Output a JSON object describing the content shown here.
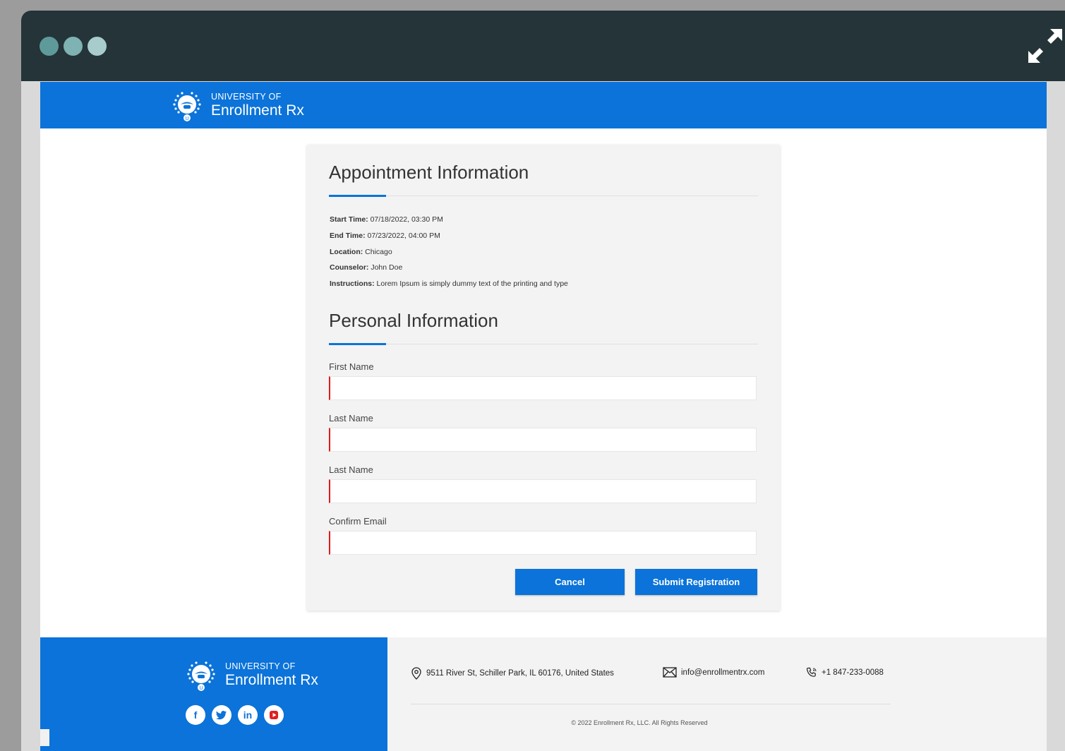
{
  "brand": {
    "subtitle": "UNIVERSITY OF",
    "name": "Enrollment Rx"
  },
  "appointment": {
    "title": "Appointment Information",
    "fields": [
      {
        "label": "Start Time:",
        "value": "07/18/2022,  03:30 PM"
      },
      {
        "label": "End Time:",
        "value": "07/23/2022,  04:00 PM"
      },
      {
        "label": "Location:",
        "value": "Chicago"
      },
      {
        "label": "Counselor:",
        "value": "John Doe"
      },
      {
        "label": "Instructions:",
        "value": "Lorem Ipsum is simply dummy text of the printing and type"
      }
    ]
  },
  "personal": {
    "title": "Personal Information",
    "fields": [
      {
        "label": "First Name",
        "value": ""
      },
      {
        "label": "Last Name",
        "value": ""
      },
      {
        "label": "Last Name",
        "value": ""
      },
      {
        "label": "Confirm Email",
        "value": ""
      }
    ]
  },
  "actions": {
    "cancel_label": "Cancel",
    "submit_label": "Submit Registration"
  },
  "footer": {
    "address": "9511 River St, Schiller Park, IL 60176,  United States",
    "email": "info@enrollmentrx.com",
    "phone": "+1 847-233-0088",
    "copyright": "© 2022 Enrollment Rx, LLC. All Rights Reserved",
    "socials": [
      {
        "name": "facebook",
        "glyph": "f"
      },
      {
        "name": "twitter",
        "glyph": ""
      },
      {
        "name": "linkedin",
        "glyph": "in"
      },
      {
        "name": "youtube",
        "glyph": ""
      }
    ]
  },
  "colors": {
    "brand_blue": "#0b73d9",
    "titlebar": "#243438",
    "required_marker": "#e01b1b"
  }
}
